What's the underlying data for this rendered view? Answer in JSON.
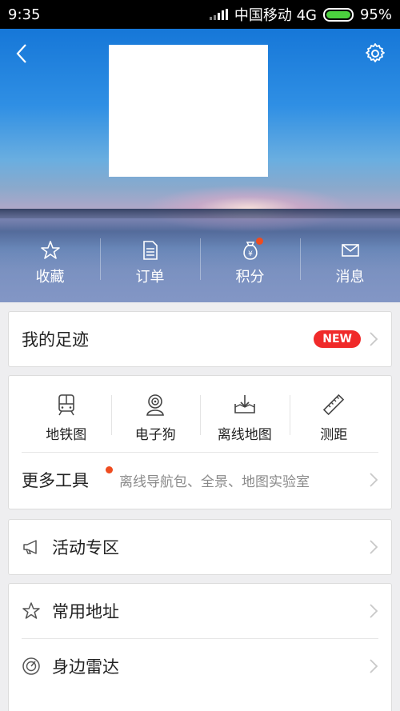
{
  "status_bar": {
    "time": "9:35",
    "carrier": "中国移动 4G",
    "battery": "95%"
  },
  "hero": {
    "nav": [
      {
        "label": "收藏",
        "icon": "star-icon"
      },
      {
        "label": "订单",
        "icon": "document-icon"
      },
      {
        "label": "积分",
        "icon": "money-bag-icon",
        "dot": true
      },
      {
        "label": "消息",
        "icon": "envelope-icon"
      }
    ]
  },
  "footprint": {
    "label": "我的足迹",
    "badge": "NEW"
  },
  "tools": {
    "items": [
      {
        "label": "地铁图",
        "icon": "subway-icon"
      },
      {
        "label": "电子狗",
        "icon": "camera-icon"
      },
      {
        "label": "离线地图",
        "icon": "offline-download-icon"
      },
      {
        "label": "测距",
        "icon": "ruler-icon"
      }
    ],
    "more_label": "更多工具",
    "more_sub": "离线导航包、全景、地图实验室"
  },
  "activity": {
    "label": "活动专区"
  },
  "common_address": {
    "label": "常用地址"
  },
  "radar": {
    "label": "身边雷达"
  },
  "colors": {
    "accent_red": "#f02a2a",
    "dot_orange": "#ef4c1f",
    "battery_green": "#4bd13e"
  }
}
